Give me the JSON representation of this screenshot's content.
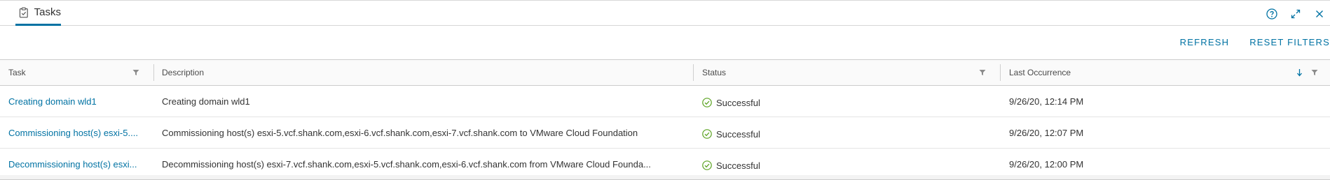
{
  "panel": {
    "tab_label": "Tasks",
    "tab_icon": "clipboard-icon",
    "header_icons": [
      "help-icon",
      "expand-icon",
      "close-icon"
    ]
  },
  "toolbar": {
    "refresh_label": "REFRESH",
    "reset_filters_label": "RESET FILTERS"
  },
  "table": {
    "columns": {
      "task": "Task",
      "description": "Description",
      "status": "Status",
      "last_occurrence": "Last Occurrence"
    },
    "rows": [
      {
        "task": "Creating domain wld1",
        "description": "Creating domain wld1",
        "status": "Successful",
        "last_occurrence": "9/26/20, 12:14 PM"
      },
      {
        "task": "Commissioning host(s) esxi-5....",
        "description": "Commissioning host(s) esxi-5.vcf.shank.com,esxi-6.vcf.shank.com,esxi-7.vcf.shank.com to VMware Cloud Foundation",
        "status": "Successful",
        "last_occurrence": "9/26/20, 12:07 PM"
      },
      {
        "task": "Decommissioning host(s) esxi...",
        "description": "Decommissioning host(s) esxi-7.vcf.shank.com,esxi-5.vcf.shank.com,esxi-6.vcf.shank.com from VMware Cloud Founda...",
        "status": "Successful",
        "last_occurrence": "9/26/20, 12:00 PM"
      }
    ]
  },
  "colors": {
    "accent": "#0072a3",
    "success": "#5aa220"
  }
}
